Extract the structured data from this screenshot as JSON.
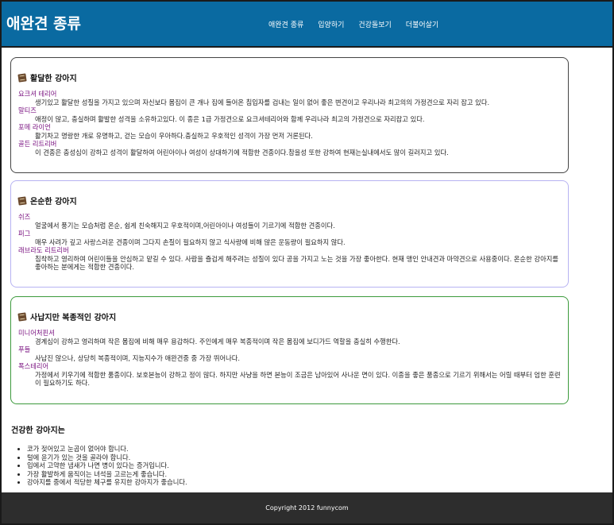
{
  "header": {
    "title": "애완견 종류",
    "nav": [
      "애완견 종류",
      "입양하기",
      "건강돌보기",
      "더불어살기"
    ]
  },
  "sections": [
    {
      "title": "활달한 강아지",
      "items": [
        {
          "name": "요크셔 테리어",
          "desc": "생기있고 활달한 성질을 가지고 있으며 자신보다 몸집이 큰 개나 집에 들어온 침입자를 겁내는 일이 없어 좋은 변견이고 우리나라 최고의의 가정견으로 자리 잡고 있다."
        },
        {
          "name": "말티즈",
          "desc": "애정이 많고, 충실하며 활발한 성격을 소유하고있다. 이 종은 1급 가정견으로 요크셔테리어와 함께 우리나라 최고의 가정견으로 자리잡고 있다."
        },
        {
          "name": "포메 라이언",
          "desc": "활기차고 명랑한 개로 유명하고, 걷는 모습이 우아하다.충실하고 우호적인 성격이 가장 먼저 거론된다."
        },
        {
          "name": "골든 리트리버",
          "desc": "이 견종은 충성심이 강하고 성격이 활달하여 어린아이나 여성이 상대하기에 적합한 견종이다.참을성 또한 강하여 현재는실내에서도 많이 길러지고 있다."
        }
      ]
    },
    {
      "title": "온순한 강아지",
      "items": [
        {
          "name": "쉬즈",
          "desc": "얼굴에서 풍기는 모습처럼 온순, 쉽게 친숙해지고 우호적이며,어린아이나 여성들이 기르기에 적합한 견종이다."
        },
        {
          "name": "퍼그",
          "desc": "매우 사려가 깊고 사랑스러운 견종이며 그다지 손질이 필요하지 않고 식사량에 비해 많은 운동량이 필요하지 않다."
        },
        {
          "name": "래브라도 리트리버",
          "desc": "침착하고 영리하여 어린이들을 안심하고 맡길 수 있다. 사람을 즐겁게 해주려는 성질이 있다 공을 가지고 노는 것을 가장 좋아한다. 현재 맹인 안내견과 마약견으로 사용중이다. 온순한 강아지를 좋아하는 분에게는 적합한 견종이다."
        }
      ]
    },
    {
      "title": "사납지만 복종적인 강아지",
      "items": [
        {
          "name": "미니어처핀셔",
          "desc": "경계심이 강하고 영리하며 작은 몸집에 비해 매우 용감하다. 주인에게 매우 복종적이며 작은 몸집에 보디가드 역할을 충실히 수행한다."
        },
        {
          "name": "푸들",
          "desc": "사납진 않으나, 상당히 복종적이며, 지능지수가 애완견중 중 가장 뛰어나다."
        },
        {
          "name": "폭스테리어",
          "desc": "가정에서 키우기에 적합한 품종이다. 보호본능이 강하고 정이 많다. 하지만 사냥을 하면 본능이 조금은 남아있어 사나운 면이 있다. 이종을 좋은 품종으로 기르기 위해서는 어릴 때부터 엄한 훈련이 필요하기도 하다."
        }
      ]
    }
  ],
  "health": {
    "title": "건강한 강아지는",
    "items": [
      "코가 젖어있고 눈곱이 없어야 합니다.",
      "털에 윤기가 있는 것을 골라야 합니다.",
      "입에서 고약한 냄새가 나면 병이 있다는 증거입니다.",
      "가장 활발하게 움직이는 녀석을 고르는게 좋습니다.",
      "강아지를 중에서 적당한 체구를 유지한 강아지가 좋습니다."
    ]
  },
  "footer": {
    "copyright": "Copyright 2012 funnycom"
  },
  "colors": {
    "header_bg": "#0a6aa1",
    "footer_bg": "#2d2d2d",
    "term": "#7a1280"
  },
  "icons": {
    "section": "book-icon"
  }
}
